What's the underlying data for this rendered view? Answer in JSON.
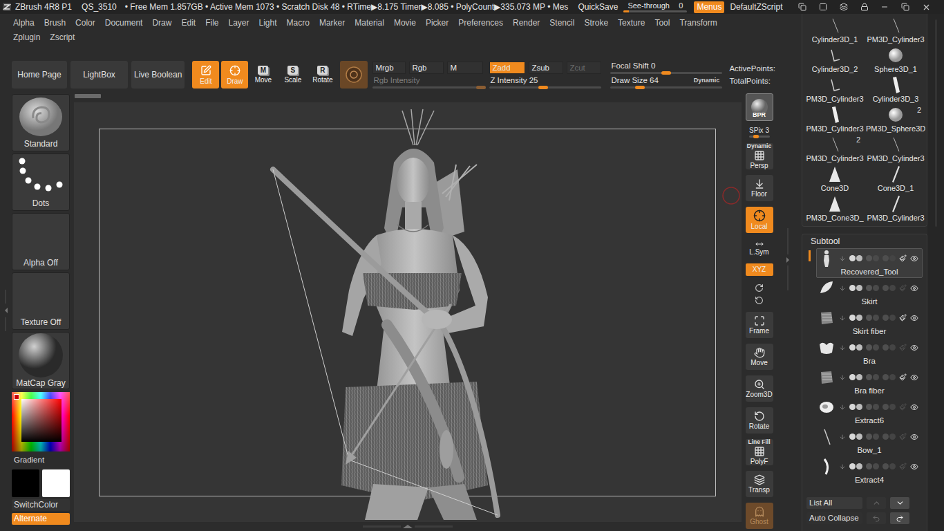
{
  "titlebar": {
    "app": "ZBrush 4R8 P1",
    "file": "QS_3510",
    "stats": "• Free Mem 1.857GB • Active Mem 1073 • Scratch Disk 48 • RTime▶8.175 Timer▶8.085 • PolyCount▶335.073 MP • Mes",
    "quicksave": "QuickSave",
    "seethrough": {
      "label": "See-through",
      "value": "0",
      "level": 0.08
    },
    "menus": {
      "label": "Menus",
      "on": true
    },
    "script": "DefaultZScript"
  },
  "menus": [
    [
      "Alpha",
      "Brush",
      "Color",
      "Document",
      "Draw",
      "Edit",
      "File",
      "Layer",
      "Light",
      "Macro",
      "Marker",
      "Material",
      "Movie",
      "Picker",
      "Preferences",
      "Render",
      "Stencil",
      "Stroke",
      "Texture",
      "Tool",
      "Transform"
    ],
    [
      "Zplugin",
      "Zscript"
    ]
  ],
  "shelf": {
    "nav": [
      "Home Page",
      "LightBox",
      "Live Boolean"
    ],
    "modes": [
      {
        "label": "Edit",
        "kind": "edit",
        "selected": true
      },
      {
        "label": "Draw",
        "kind": "draw",
        "selected": true
      },
      {
        "label": "Move",
        "kind": "key",
        "key": "M",
        "selected": false
      },
      {
        "label": "Scale",
        "kind": "key",
        "key": "S",
        "selected": false
      },
      {
        "label": "Rotate",
        "kind": "key",
        "key": "R",
        "selected": false
      }
    ],
    "channels": [
      {
        "label": "Mrgb",
        "selected": false,
        "disabled": false
      },
      {
        "label": "Rgb",
        "selected": false,
        "disabled": false
      },
      {
        "label": "M",
        "selected": false,
        "disabled": false
      }
    ],
    "zmodes": [
      {
        "label": "Zadd",
        "selected": true,
        "disabled": false
      },
      {
        "label": "Zsub",
        "selected": false,
        "disabled": false
      },
      {
        "label": "Zcut",
        "selected": false,
        "disabled": true
      }
    ],
    "rgb_intensity": {
      "label": "Rgb Intensity",
      "level": 0.96,
      "disabled": true
    },
    "z_intensity": {
      "label": "Z Intensity 25",
      "level": 0.48,
      "disabled": false
    },
    "focal_shift": {
      "label": "Focal Shift 0",
      "level": 0.5,
      "disabled": false
    },
    "draw_size": {
      "label": "Draw Size 64",
      "level": 0.26,
      "disabled": false,
      "dynamic": "Dynamic"
    },
    "points": [
      "ActivePoints:",
      "TotalPoints:"
    ]
  },
  "left_shelf": {
    "brush": "Standard",
    "stroke": "Dots",
    "alpha": "Alpha Off",
    "texture": "Texture Off",
    "material": "MatCap Gray",
    "gradient": "Gradient",
    "main_color": "#000000",
    "secondary_color": "#ffffff",
    "switch": "SwitchColor",
    "alternate": {
      "label": "Alternate",
      "on": true
    }
  },
  "right_shelf": [
    {
      "label": "BPR",
      "kind": "render",
      "on": false
    },
    {
      "label": "SPix 3",
      "kind": "slider",
      "level": 0.35
    },
    {
      "label": "Persp",
      "caption": "Dynamic",
      "kind": "button",
      "on": false,
      "muted": false
    },
    {
      "label": "Floor",
      "kind": "button",
      "on": false,
      "muted": false
    },
    {
      "label": "Local",
      "kind": "button",
      "on": true,
      "muted": false
    },
    {
      "label": "L.Sym",
      "kind": "small",
      "on": false
    },
    {
      "label": "XYZ",
      "kind": "small",
      "on": true
    },
    {
      "kind": "rotators"
    },
    {
      "label": "Frame",
      "kind": "button",
      "on": false,
      "muted": false
    },
    {
      "label": "Move",
      "kind": "button",
      "on": false,
      "muted": false
    },
    {
      "label": "Zoom3D",
      "kind": "button",
      "on": false,
      "muted": false
    },
    {
      "label": "Rotate",
      "kind": "button",
      "on": false,
      "muted": false
    },
    {
      "label": "PolyF",
      "caption": "Line Fill",
      "kind": "button",
      "on": false,
      "muted": false
    },
    {
      "label": "Transp",
      "kind": "button",
      "on": false,
      "muted": false
    },
    {
      "label": "Ghost",
      "kind": "button",
      "on": true,
      "muted": true
    },
    {
      "label": "Dynamic",
      "kind": "caption"
    }
  ],
  "tools": [
    {
      "label": "Cylinder3D_1",
      "kind": "line"
    },
    {
      "label": "PM3D_Cylinder3",
      "kind": "line"
    },
    {
      "label": "Cylinder3D_2",
      "kind": "bent"
    },
    {
      "label": "Sphere3D_1",
      "kind": "sphere"
    },
    {
      "label": "PM3D_Cylinder3",
      "kind": "bent"
    },
    {
      "label": "Cylinder3D_3",
      "kind": "cylinder"
    },
    {
      "label": "PM3D_Cylinder3",
      "kind": "cylinder"
    },
    {
      "label": "PM3D_Sphere3D",
      "kind": "sphere",
      "badge": "2"
    },
    {
      "label": "PM3D_Cylinder3",
      "kind": "line",
      "badge": "2"
    },
    {
      "label": "PM3D_Cylinder3",
      "kind": "line"
    },
    {
      "label": "Cone3D",
      "kind": "cone"
    },
    {
      "label": "Cone3D_1",
      "kind": "thin"
    },
    {
      "label": "PM3D_Cone3D_",
      "kind": "cone"
    },
    {
      "label": "PM3D_Cylinder3",
      "kind": "thin"
    }
  ],
  "subtool": {
    "title": "Subtool",
    "items": [
      {
        "name": "Recovered_Tool",
        "kind": "figure",
        "selected": true,
        "polypaint": true,
        "visible": true
      },
      {
        "name": "Skirt",
        "kind": "leaf",
        "selected": false,
        "polypaint": false,
        "visible": true
      },
      {
        "name": "Skirt fiber",
        "kind": "fiber",
        "selected": false,
        "polypaint": true,
        "visible": true
      },
      {
        "name": "Bra",
        "kind": "bra",
        "selected": false,
        "polypaint": false,
        "visible": true
      },
      {
        "name": "Bra fiber",
        "kind": "fiber",
        "selected": false,
        "polypaint": true,
        "visible": true
      },
      {
        "name": "Extract6",
        "kind": "blob",
        "selected": false,
        "polypaint": false,
        "visible": true
      },
      {
        "name": "Bow_1",
        "kind": "line",
        "selected": false,
        "polypaint": false,
        "visible": true
      },
      {
        "name": "Extract4",
        "kind": "curve",
        "selected": false,
        "polypaint": false,
        "visible": true
      }
    ],
    "list_all": "List All",
    "auto_collapse": "Auto Collapse"
  }
}
